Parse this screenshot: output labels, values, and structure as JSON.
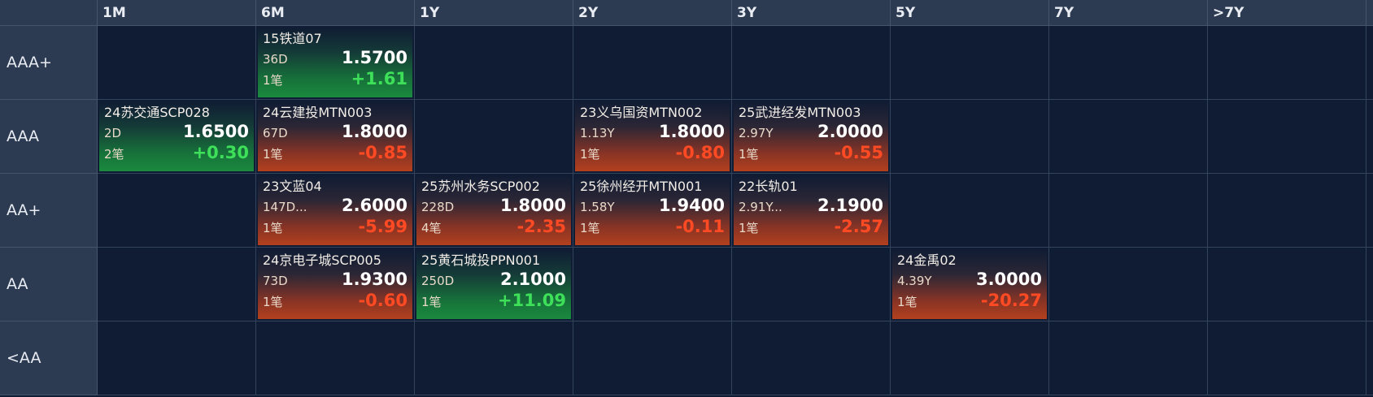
{
  "columns": [
    "1M",
    "6M",
    "1Y",
    "2Y",
    "3Y",
    "5Y",
    "7Y",
    ">7Y"
  ],
  "rows": [
    "AAA+",
    "AAA",
    "AA+",
    "AA",
    "<AA"
  ],
  "colors": {
    "up": "#3ee05a",
    "down": "#ff4a24",
    "header_bg": "#2c3a52",
    "cell_bg": "#101c34"
  },
  "cards": {
    "r0c1": {
      "name": "15铁道07",
      "term": "36D",
      "rate": "1.5700",
      "count": "1笔",
      "change": "+1.61",
      "trend": "up"
    },
    "r1c0": {
      "name": "24苏交通SCP028",
      "term": "2D",
      "rate": "1.6500",
      "count": "2笔",
      "change": "+0.30",
      "trend": "up"
    },
    "r1c1": {
      "name": "24云建投MTN003",
      "term": "67D",
      "rate": "1.8000",
      "count": "1笔",
      "change": "-0.85",
      "trend": "down"
    },
    "r1c3": {
      "name": "23义乌国资MTN002",
      "term": "1.13Y",
      "rate": "1.8000",
      "count": "1笔",
      "change": "-0.80",
      "trend": "down"
    },
    "r1c4": {
      "name": "25武进经发MTN003",
      "term": "2.97Y",
      "rate": "2.0000",
      "count": "1笔",
      "change": "-0.55",
      "trend": "down"
    },
    "r2c1": {
      "name": "23文蓝04",
      "term": "147D...",
      "rate": "2.6000",
      "count": "1笔",
      "change": "-5.99",
      "trend": "down"
    },
    "r2c2": {
      "name": "25苏州水务SCP002",
      "term": "228D",
      "rate": "1.8000",
      "count": "4笔",
      "change": "-2.35",
      "trend": "down"
    },
    "r2c3": {
      "name": "25徐州经开MTN001",
      "term": "1.58Y",
      "rate": "1.9400",
      "count": "1笔",
      "change": "-0.11",
      "trend": "down"
    },
    "r2c4": {
      "name": "22长轨01",
      "term": "2.91Y...",
      "rate": "2.1900",
      "count": "1笔",
      "change": "-2.57",
      "trend": "down"
    },
    "r3c1": {
      "name": "24京电子城SCP005",
      "term": "73D",
      "rate": "1.9300",
      "count": "1笔",
      "change": "-0.60",
      "trend": "down"
    },
    "r3c2": {
      "name": "25黄石城投PPN001",
      "term": "250D",
      "rate": "2.1000",
      "count": "1笔",
      "change": "+11.09",
      "trend": "up"
    },
    "r3c5": {
      "name": "24金禹02",
      "term": "4.39Y",
      "rate": "3.0000",
      "count": "1笔",
      "change": "-20.27",
      "trend": "down"
    }
  }
}
